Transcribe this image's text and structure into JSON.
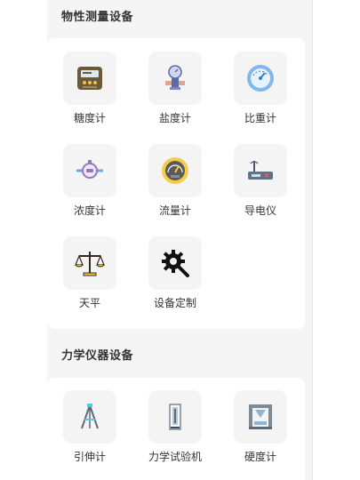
{
  "sections": [
    {
      "title": "物性测量设备",
      "items": [
        {
          "label": "糖度计",
          "icon": "sugar-meter-icon"
        },
        {
          "label": "盐度计",
          "icon": "salinity-meter-icon"
        },
        {
          "label": "比重计",
          "icon": "gravity-meter-icon"
        },
        {
          "label": "浓度计",
          "icon": "concentration-meter-icon"
        },
        {
          "label": "流量计",
          "icon": "flow-meter-icon"
        },
        {
          "label": "导电仪",
          "icon": "conductivity-meter-icon"
        },
        {
          "label": "天平",
          "icon": "balance-scale-icon"
        },
        {
          "label": "设备定制",
          "icon": "custom-gear-icon"
        }
      ]
    },
    {
      "title": "力学仪器设备",
      "items": [
        {
          "label": "引伸计",
          "icon": "extensometer-icon"
        },
        {
          "label": "力学试验机",
          "icon": "testing-machine-icon"
        },
        {
          "label": "硬度计",
          "icon": "hardness-tester-icon"
        }
      ]
    }
  ],
  "colors": {
    "background": "#f5f5f5",
    "card": "#ffffff",
    "icon_tile": "#f4f4f4",
    "text": "#333333"
  }
}
